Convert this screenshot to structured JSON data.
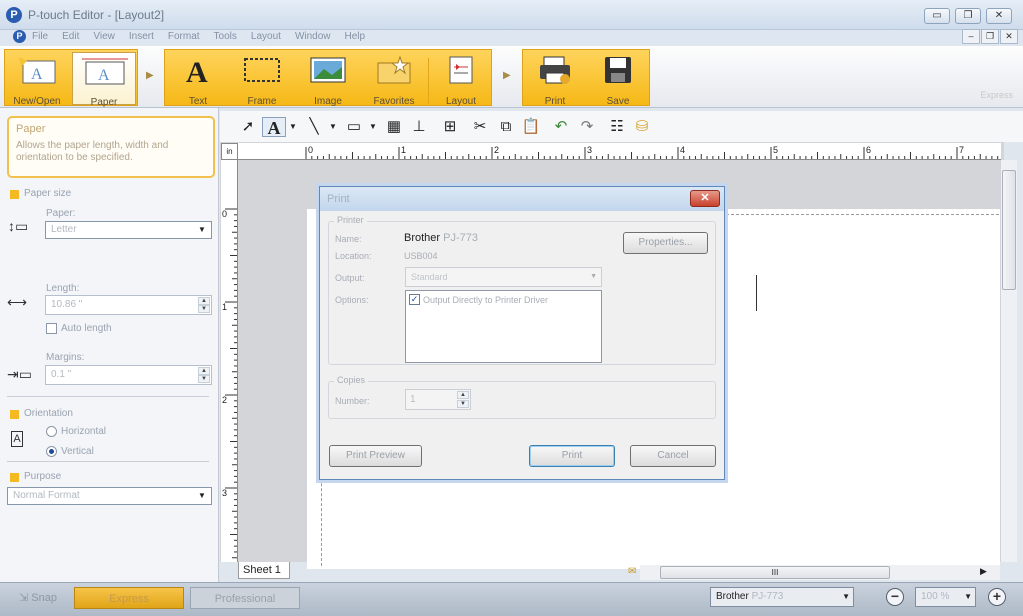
{
  "window": {
    "title": "P-touch Editor - [Layout2]",
    "buttons": {
      "minimize": "▭",
      "restore": "❐",
      "close": "✕"
    }
  },
  "menu": {
    "items": [
      "File",
      "Edit",
      "View",
      "Insert",
      "Format",
      "Tools",
      "Layout",
      "Window",
      "Help"
    ],
    "mdi_buttons": {
      "minimize": "–",
      "restore": "❐",
      "close": "✕"
    }
  },
  "ribbon": {
    "buttons": [
      {
        "label": "New/Open",
        "icon": "new-open-icon"
      },
      {
        "label": "Paper",
        "icon": "paper-icon"
      },
      {
        "label": "Text",
        "icon": "text-icon"
      },
      {
        "label": "Frame",
        "icon": "frame-icon"
      },
      {
        "label": "Image",
        "icon": "image-icon"
      },
      {
        "label": "Favorites",
        "icon": "favorites-icon"
      },
      {
        "label": "Layout",
        "icon": "layout-icon"
      },
      {
        "label": "Print",
        "icon": "print-icon"
      },
      {
        "label": "Save",
        "icon": "save-icon"
      }
    ],
    "mode_label": "Express"
  },
  "properties": {
    "title": "Paper",
    "description": "Allows the paper length, width and orientation to be specified.",
    "paper_size_section": "Paper size",
    "paper_label": "Paper:",
    "paper_value": "Letter",
    "length_label": "Length:",
    "length_value": "10.86 \"",
    "auto_length_label": "Auto length",
    "margins_label": "Margins:",
    "margins_value": "0.1 \"",
    "orientation_section": "Orientation",
    "orientation_horizontal": "Horizontal",
    "orientation_vertical": "Vertical",
    "purpose_section": "Purpose",
    "purpose_value": "Normal Format"
  },
  "ruler": {
    "unit": "in",
    "top_numbers": [
      "0",
      "1",
      "2",
      "3",
      "4",
      "5",
      "6",
      "7"
    ],
    "left_numbers": [
      "0",
      "1",
      "2",
      "3"
    ]
  },
  "canvas": {
    "sheet_tab": "Sheet 1",
    "hscroll_grip": "III"
  },
  "print_dialog": {
    "title": "Print",
    "close": "✕",
    "printer_group": "Printer",
    "name_label": "Name:",
    "name_brand": "Brother",
    "name_model": "PJ-773",
    "location_label": "Location:",
    "location_value": "USB004",
    "properties_button": "Properties...",
    "output_label": "Output:",
    "output_value": "Standard",
    "options_label": "Options:",
    "option_item": "Output Directly to Printer Driver",
    "copies_group": "Copies",
    "number_label": "Number:",
    "number_value": "1",
    "print_preview_button": "Print Preview",
    "print_button": "Print",
    "cancel_button": "Cancel"
  },
  "statusbar": {
    "snap": "Snap",
    "express": "Express",
    "professional": "Professional",
    "printer_brand": "Brother",
    "printer_model": "PJ-773",
    "zoom": "100 %"
  }
}
